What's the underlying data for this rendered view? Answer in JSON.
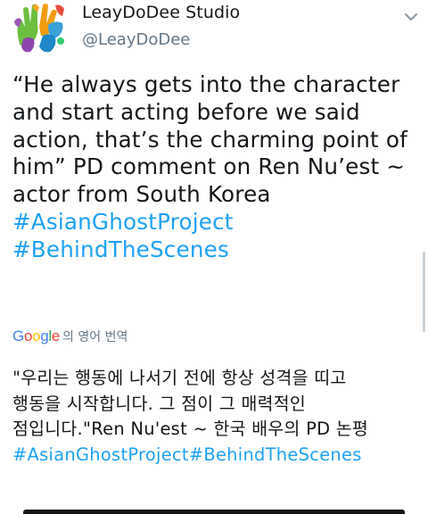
{
  "author": {
    "display_name": "LeayDoDee Studio",
    "handle": "@LeayDoDee",
    "avatar_icon": "colorful-hands-logo-icon"
  },
  "menu": {
    "icon": "chevron-down-icon"
  },
  "tweet": {
    "lines": [
      "“He always gets into the character",
      "and start acting before we said",
      "action, that’s the charming point of",
      "him” PD comment on Ren Nu’est ~",
      "actor from South Korea"
    ],
    "hashtags": [
      "#AsianGhostProject",
      "#BehindTheScenes"
    ]
  },
  "translation": {
    "provider_letters": [
      "G",
      "o",
      "o",
      "g",
      "l",
      "e"
    ],
    "label": "의 영어 번역",
    "lines": [
      "\"우리는 행동에 나서기 전에 항상 성격을 띠고",
      "행동을 시작합니다. 그 점이 그 매력적인",
      "점입니다.\"Ren Nu'est ~ 한국 배우의 PD 논평"
    ],
    "hashtags": "#AsianGhostProject#BehindTheScenes"
  },
  "colors": {
    "link": "#1da1f2",
    "text": "#14171a",
    "muted": "#657786",
    "google": [
      "#4285f4",
      "#ea4335",
      "#fbbc05",
      "#4285f4",
      "#34a853",
      "#ea4335"
    ]
  }
}
